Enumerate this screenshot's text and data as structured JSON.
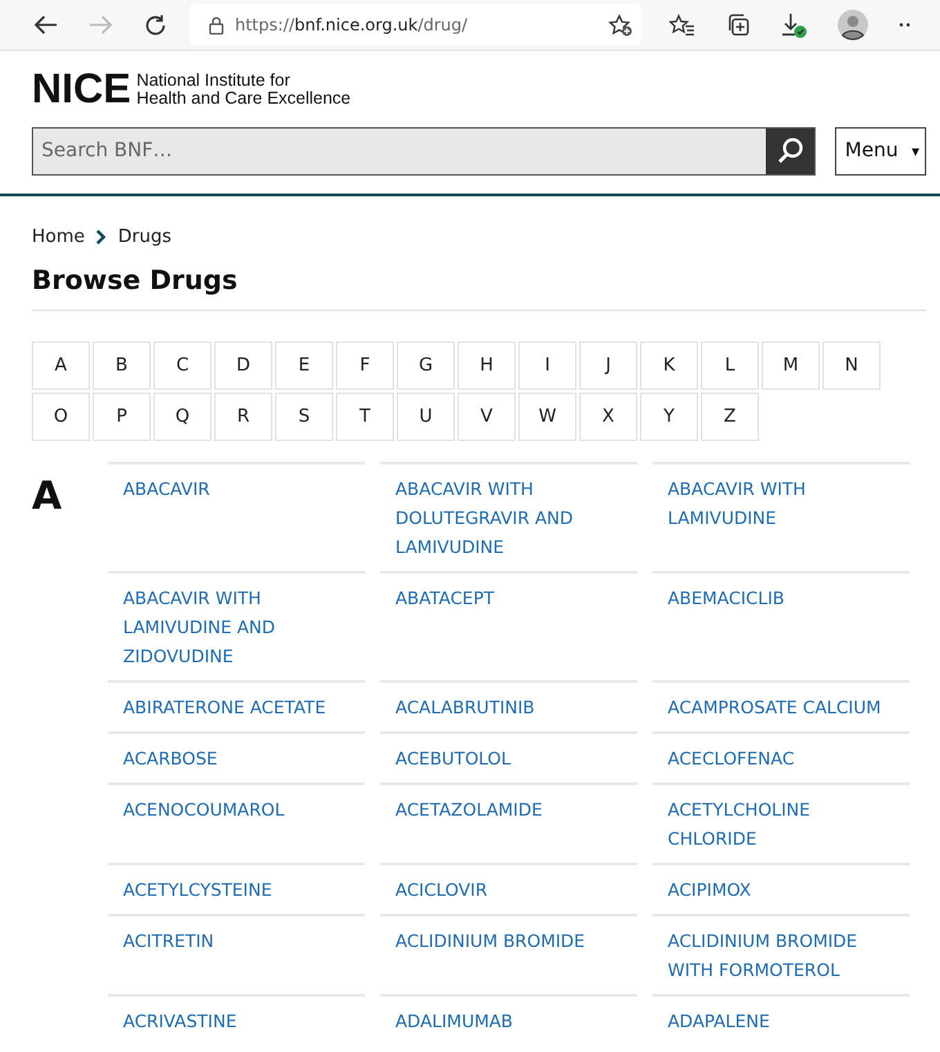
{
  "browser": {
    "url_scheme": "https://",
    "url_host": "bnf.nice.org.uk",
    "url_path": "/drug/",
    "forward_disabled": true
  },
  "header": {
    "logo": "NICE",
    "logo_line_1": "National Institute for",
    "logo_line_2": "Health and Care Excellence",
    "search": {
      "placeholder": "Search BNF…"
    },
    "menu_label": "Menu",
    "menu_caret": "▾"
  },
  "breadcrumb": [
    "Home",
    "Drugs"
  ],
  "heading": "Browse Drugs",
  "letters": [
    "A",
    "B",
    "C",
    "D",
    "E",
    "F",
    "G",
    "H",
    "I",
    "J",
    "K",
    "L",
    "M",
    "N",
    "O",
    "P",
    "Q",
    "R",
    "S",
    "T",
    "U",
    "V",
    "W",
    "X",
    "Y",
    "Z"
  ],
  "section": {
    "letter": "A",
    "drugs": [
      "ABACAVIR",
      "ABACAVIR WITH DOLUTEGRAVIR AND LAMIVUDINE",
      "ABACAVIR WITH LAMIVUDINE",
      "ABACAVIR WITH LAMIVUDINE AND ZIDOVUDINE",
      "ABATACEPT",
      "ABEMACICLIB",
      "ABIRATERONE ACETATE",
      "ACALABRUTINIB",
      "ACAMPROSATE CALCIUM",
      "ACARBOSE",
      "ACEBUTOLOL",
      "ACECLOFENAC",
      "ACENOCOUMAROL",
      "ACETAZOLAMIDE",
      "ACETYLCHOLINE CHLORIDE",
      "ACETYLCYSTEINE",
      "ACICLOVIR",
      "ACIPIMOX",
      "ACITRETIN",
      "ACLIDINIUM BROMIDE",
      "ACLIDINIUM BROMIDE WITH FORMOTEROL",
      "ACRIVASTINE",
      "ADALIMUMAB",
      "ADAPALENE"
    ]
  }
}
